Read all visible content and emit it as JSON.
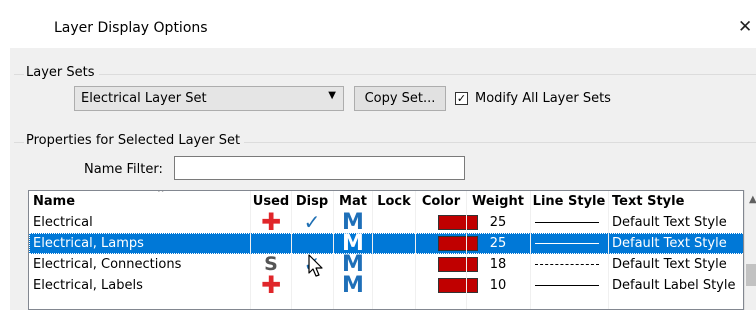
{
  "window": {
    "title": "Layer Display Options",
    "close_label": "✕"
  },
  "layer_sets": {
    "group_label": "Layer Sets",
    "selected_set": "Electrical Layer Set",
    "copy_button": "Copy Set...",
    "modify_all": {
      "label": "Modify All Layer Sets",
      "checked": true
    }
  },
  "properties": {
    "group_label": "Properties for Selected Layer Set",
    "name_filter_label": "Name Filter:",
    "name_filter_value": ""
  },
  "table": {
    "columns": [
      "Name",
      "Used",
      "Disp",
      "Mat",
      "Lock",
      "Color",
      "Weight",
      "Line Style",
      "Text Style"
    ],
    "rows": [
      {
        "name": "Electrical",
        "used": "plus",
        "disp": true,
        "mat": "M",
        "lock": false,
        "color": "#c00000",
        "weight": "25",
        "line_style": "solid",
        "text_style": "Default Text Style",
        "selected": false
      },
      {
        "name": "Electrical, Lamps",
        "used": "",
        "disp": false,
        "mat": "M",
        "lock": false,
        "color": "#c00000",
        "weight": "25",
        "line_style": "solid",
        "text_style": "Default Text Style",
        "selected": true
      },
      {
        "name": "Electrical, Connections",
        "used": "S",
        "disp": true,
        "mat": "M",
        "lock": false,
        "color": "#c00000",
        "weight": "18",
        "line_style": "dashed",
        "text_style": "Default Text Style",
        "selected": false
      },
      {
        "name": "Electrical, Labels",
        "used": "plus",
        "disp": false,
        "mat": "M",
        "lock": false,
        "color": "#c00000",
        "weight": "10",
        "line_style": "solid",
        "text_style": "Default Label Style",
        "selected": false
      }
    ]
  },
  "colors": {
    "selection": "#0078d7",
    "used_plus": "#e0262a",
    "check": "#1f6fb3",
    "mat": "#1e6fb8"
  }
}
